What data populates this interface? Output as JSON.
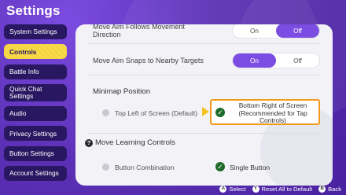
{
  "title": "Settings",
  "sidebar": {
    "items": [
      {
        "label": "System Settings"
      },
      {
        "label": "Controls"
      },
      {
        "label": "Battle Info"
      },
      {
        "label": "Quick Chat Settings"
      },
      {
        "label": "Audio"
      },
      {
        "label": "Privacy Settings"
      },
      {
        "label": "Button Settings"
      },
      {
        "label": "Account Settings"
      }
    ]
  },
  "panel": {
    "move_aim_follows": {
      "label": "Move Aim Follows Movement Direction",
      "on": "On",
      "off": "Off",
      "selected": "Off"
    },
    "move_aim_snaps": {
      "label": "Move Aim Snaps to Nearby Targets",
      "on": "On",
      "off": "Off",
      "selected": "On"
    },
    "minimap": {
      "heading": "Minimap Position",
      "opt1": "Top Left of Screen (Default)",
      "opt2": "Bottom Right of Screen (Recommended for Tap Controls)"
    },
    "move_learning": {
      "heading": "Move Learning Controls",
      "help_glyph": "?",
      "opt1": "Button Combination",
      "opt2": "Single Button"
    }
  },
  "footer": {
    "select": {
      "key": "A",
      "label": "Select"
    },
    "reset": {
      "key": "Y",
      "label": "Reset All to Default"
    },
    "back": {
      "key": "B",
      "label": "Back"
    }
  },
  "colors": {
    "background": "#5a2fb4",
    "accent": "#7b4de2",
    "active_tab": "#f5d53a",
    "highlight_border": "#f39a1c",
    "check": "#1f6b2a"
  }
}
